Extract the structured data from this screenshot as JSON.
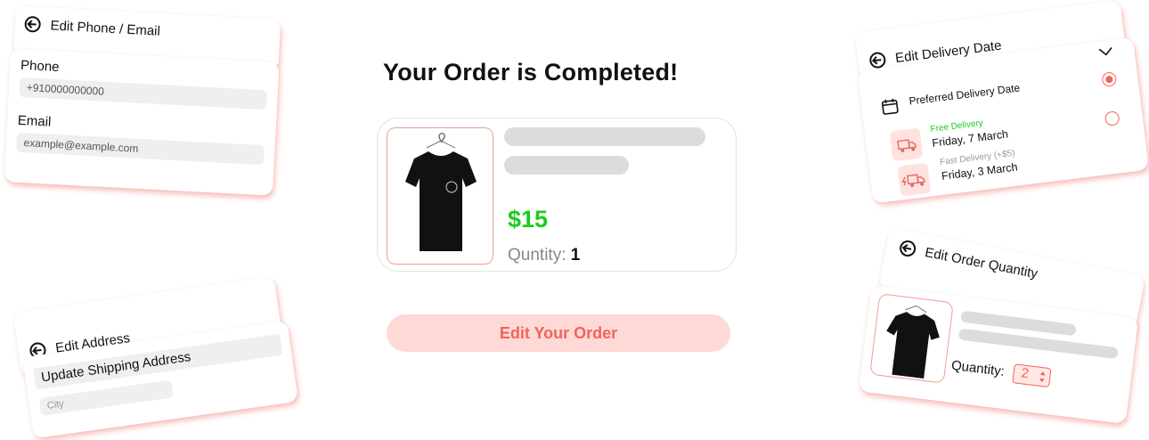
{
  "center": {
    "title": "Your Order is Completed!",
    "price": "$15",
    "quantity_label": "Quntity:",
    "quantity_value": "1",
    "edit_button": "Edit Your Order"
  },
  "phone_email": {
    "title": "Edit Phone / Email",
    "phone_label": "Phone",
    "phone_value": "+910000000000",
    "email_label": "Email",
    "email_value": "example@example.com"
  },
  "address": {
    "title": "Edit Address",
    "update_label": "Update Shipping Address",
    "city_placeholder": "City"
  },
  "delivery": {
    "title": "Edit Delivery Date",
    "preferred_label": "Preferred Delivery Date",
    "options": [
      {
        "tag": "Free Delivery",
        "date": "Friday, 7 March",
        "selected": true
      },
      {
        "tag": "Fast Delivery (+$5)",
        "date": "Friday, 3 March",
        "selected": false
      }
    ]
  },
  "quantity_card": {
    "title": "Edit Order Quantity",
    "label": "Quantity:",
    "value": "2"
  },
  "colors": {
    "accent": "#f0645a",
    "accent_light": "#ffd9d6",
    "price_green": "#1ccc1c",
    "free_green": "#1ccc1c"
  },
  "icons": [
    "back-arrow-icon",
    "calendar-icon",
    "truck-icon",
    "fast-truck-icon",
    "chevron-down-icon",
    "tshirt-image",
    "stepper-arrows-icon"
  ]
}
